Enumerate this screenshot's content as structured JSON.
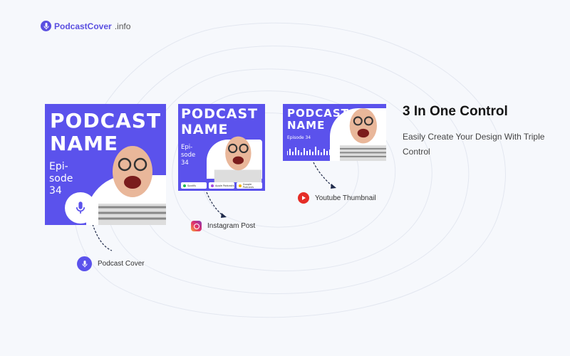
{
  "brand": {
    "name": "PodcastCover",
    "tld": ".info",
    "icon": "microphone-icon"
  },
  "heading": "3 In One Control",
  "subheading": "Easily Create Your Design With Triple Control",
  "cards": {
    "podcast": {
      "title1": "PODCAST",
      "title2": "NAME",
      "episode1": "Epi-",
      "episode2": "sode",
      "episode3": "34",
      "label": "Podcast Cover",
      "icon": "microphone-icon"
    },
    "instagram": {
      "title1": "PODCAST",
      "title2": "NAME",
      "episode1": "Epi-",
      "episode2": "sode",
      "episode3": "34",
      "label": "Instagram Post",
      "icon": "instagram-icon",
      "badges": [
        "Spotify",
        "Apple Podcasts",
        "Google Podcasts"
      ]
    },
    "youtube": {
      "title1": "PODCAST",
      "title2": "NAME",
      "episode": "Episode 34",
      "label": "Youtube Thumbnail",
      "icon": "youtube-icon"
    }
  },
  "colors": {
    "accent": "#5b52ec",
    "youtube": "#e52d27"
  }
}
